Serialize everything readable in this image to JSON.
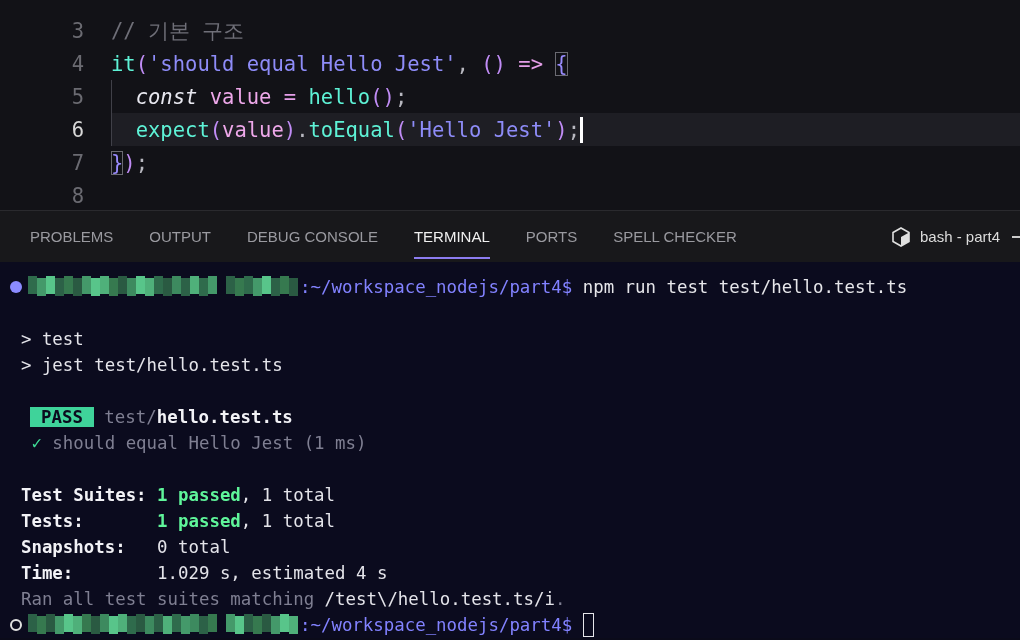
{
  "editor": {
    "lines": [
      {
        "number": "3",
        "current": false,
        "indent_guide": false,
        "tokens": [
          {
            "text": "// 기본 구조",
            "kind": "comment"
          }
        ]
      },
      {
        "number": "4",
        "current": false,
        "indent_guide": false,
        "tokens": [
          {
            "text": "it",
            "kind": "func"
          },
          {
            "text": "(",
            "kind": "paren"
          },
          {
            "text": "'should equal Hello Jest'",
            "kind": "string"
          },
          {
            "text": ", ",
            "kind": "punct"
          },
          {
            "text": "()",
            "kind": "paren"
          },
          {
            "text": " => ",
            "kind": "op"
          },
          {
            "text": "{",
            "kind": "match"
          }
        ]
      },
      {
        "number": "5",
        "current": false,
        "indent_guide": true,
        "tokens": [
          {
            "text": "const",
            "kind": "keyword"
          },
          {
            "text": " value",
            "kind": "var"
          },
          {
            "text": " = ",
            "kind": "op"
          },
          {
            "text": "hello",
            "kind": "func"
          },
          {
            "text": "()",
            "kind": "paren"
          },
          {
            "text": ";",
            "kind": "punct"
          }
        ]
      },
      {
        "number": "6",
        "current": true,
        "indent_guide": true,
        "cursor": true,
        "tokens": [
          {
            "text": "expect",
            "kind": "func"
          },
          {
            "text": "(",
            "kind": "paren"
          },
          {
            "text": "value",
            "kind": "var"
          },
          {
            "text": ")",
            "kind": "paren"
          },
          {
            "text": ".",
            "kind": "punct"
          },
          {
            "text": "toEqual",
            "kind": "func"
          },
          {
            "text": "(",
            "kind": "paren"
          },
          {
            "text": "'Hello Jest'",
            "kind": "string"
          },
          {
            "text": ")",
            "kind": "paren"
          },
          {
            "text": ";",
            "kind": "punct"
          }
        ]
      },
      {
        "number": "7",
        "current": false,
        "indent_guide": false,
        "tokens": [
          {
            "text": "}",
            "kind": "match"
          },
          {
            "text": ")",
            "kind": "paren"
          },
          {
            "text": ";",
            "kind": "punct"
          }
        ]
      },
      {
        "number": "8",
        "current": false,
        "indent_guide": false
      }
    ]
  },
  "panel": {
    "tabs": [
      {
        "label": "PROBLEMS",
        "selected": false
      },
      {
        "label": "OUTPUT",
        "selected": false
      },
      {
        "label": "DEBUG CONSOLE",
        "selected": false
      },
      {
        "label": "TERMINAL",
        "selected": true
      },
      {
        "label": "PORTS",
        "selected": false
      },
      {
        "label": "SPELL CHECKER",
        "selected": false
      }
    ],
    "terminal_name": "bash - part4"
  },
  "terminal": {
    "lines": [
      {
        "kind": "prompt",
        "completed": true,
        "path": ":~/workspace_nodejs/part4$",
        "command": " npm run test test/hello.test.ts"
      },
      {
        "kind": "blank"
      },
      {
        "kind": "output",
        "segments": [
          {
            "text": "  > test",
            "kind": "plain"
          }
        ]
      },
      {
        "kind": "output",
        "segments": [
          {
            "text": "  > jest test/hello.test.ts",
            "kind": "plain"
          }
        ]
      },
      {
        "kind": "blank"
      },
      {
        "kind": "output",
        "segments": [
          {
            "text": "PASS",
            "kind": "badge"
          },
          {
            "text": " test/",
            "kind": "dim"
          },
          {
            "text": "hello.test.ts",
            "kind": "bold"
          }
        ]
      },
      {
        "kind": "output",
        "segments": [
          {
            "text": "   ✓",
            "kind": "check"
          },
          {
            "text": " should equal Hello Jest (1 ms)",
            "kind": "dim"
          }
        ]
      },
      {
        "kind": "blank"
      },
      {
        "kind": "output",
        "segments": [
          {
            "text": "  Test Suites: ",
            "kind": "bold"
          },
          {
            "text": "1 passed",
            "kind": "pass"
          },
          {
            "text": ", 1 total",
            "kind": "plain"
          }
        ]
      },
      {
        "kind": "output",
        "segments": [
          {
            "text": "  Tests:       ",
            "kind": "bold"
          },
          {
            "text": "1 passed",
            "kind": "pass"
          },
          {
            "text": ", 1 total",
            "kind": "plain"
          }
        ]
      },
      {
        "kind": "output",
        "segments": [
          {
            "text": "  Snapshots:   ",
            "kind": "bold"
          },
          {
            "text": "0 total",
            "kind": "plain"
          }
        ]
      },
      {
        "kind": "output",
        "segments": [
          {
            "text": "  Time:        ",
            "kind": "bold"
          },
          {
            "text": "1.029 s, estimated 4 s",
            "kind": "plain"
          }
        ]
      },
      {
        "kind": "output",
        "segments": [
          {
            "text": "  Ran all test suites matching ",
            "kind": "dim"
          },
          {
            "text": "/test\\/hello.test.ts/i",
            "kind": "plain"
          },
          {
            "text": ".",
            "kind": "dim"
          }
        ]
      },
      {
        "kind": "prompt",
        "completed": false,
        "cursor": true,
        "path": ":~/workspace_nodejs/part4$"
      }
    ]
  }
}
